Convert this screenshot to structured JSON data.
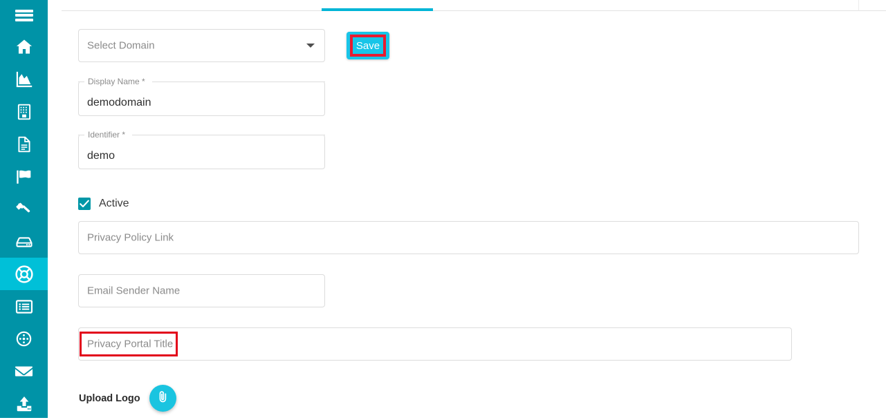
{
  "sidebar": {
    "background_color": "#0093a7",
    "active_color": "#00c0d8",
    "menu_toggle": "menu-hamburger",
    "items": [
      {
        "icon": "home-icon",
        "name": "home",
        "active": false
      },
      {
        "icon": "chart-area-icon",
        "name": "analytics",
        "active": false
      },
      {
        "icon": "building-icon",
        "name": "organization",
        "active": false
      },
      {
        "icon": "document-icon",
        "name": "documents",
        "active": false
      },
      {
        "icon": "flag-icon",
        "name": "flags",
        "active": false
      },
      {
        "icon": "gavel-icon",
        "name": "legal",
        "active": false
      },
      {
        "icon": "database-icon",
        "name": "data-store",
        "active": false
      },
      {
        "icon": "lifebuoy-icon",
        "name": "support",
        "active": true
      },
      {
        "icon": "list-card-icon",
        "name": "records",
        "active": false
      },
      {
        "icon": "cookie-icon",
        "name": "cookies",
        "active": false
      },
      {
        "icon": "envelope-icon",
        "name": "email",
        "active": false
      },
      {
        "icon": "upload-icon",
        "name": "upload",
        "active": false
      }
    ]
  },
  "tabs": {
    "active_indicator_color": "#00b5d6"
  },
  "form": {
    "select_domain": {
      "label": "Select Domain",
      "value": "",
      "placeholder": "Select Domain"
    },
    "save": {
      "label": "Save",
      "button_color": "#18c5e8",
      "highlight_color": "#e81b30"
    },
    "display_name": {
      "label": "Display Name *",
      "value": "demodomain"
    },
    "identifier": {
      "label": "Identifier *",
      "value": "demo"
    },
    "active": {
      "label": "Active",
      "checked": true,
      "checkbox_color": "#0097a7"
    },
    "privacy_policy_link": {
      "placeholder": "Privacy Policy Link",
      "value": ""
    },
    "email_sender_name": {
      "placeholder": "Email Sender Name",
      "value": ""
    },
    "privacy_portal_title": {
      "placeholder": "Privacy Portal Title",
      "value": "",
      "highlight_color": "#e2001a"
    },
    "upload_logo": {
      "label": "Upload Logo",
      "button_icon": "paperclip-icon",
      "button_color": "#1ac4e0"
    }
  }
}
